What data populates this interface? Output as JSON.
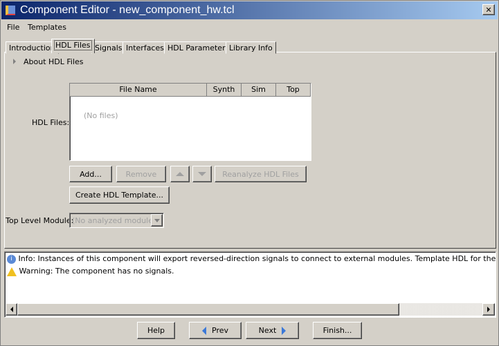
{
  "window": {
    "title": "Component Editor - new_component_hw.tcl",
    "close": "✕"
  },
  "menu": [
    "File",
    "Templates"
  ],
  "tabs": [
    "Introduction",
    "HDL Files",
    "Signals",
    "Interfaces",
    "HDL Parameters",
    "Library Info"
  ],
  "active_tab": "HDL Files",
  "about": "About HDL Files",
  "hdl_files": {
    "label": "HDL Files:",
    "columns": [
      "File Name",
      "Synth",
      "Sim",
      "Top"
    ],
    "empty": "(No files)"
  },
  "buttons": {
    "add": "Add...",
    "remove": "Remove",
    "reanalyze": "Reanalyze HDL Files",
    "create_template": "Create HDL Template..."
  },
  "top_level": {
    "label": "Top Level Module:",
    "value": "(No analyzed modules)"
  },
  "messages": [
    {
      "type": "info",
      "text": "Info: Instances of this component will export reversed-direction signals to connect to external modules. Template HDL for the component can b"
    },
    {
      "type": "warning",
      "text": "Warning: The component has no signals."
    }
  ],
  "footer": {
    "help": "Help",
    "prev": "Prev",
    "next": "Next",
    "finish": "Finish..."
  }
}
